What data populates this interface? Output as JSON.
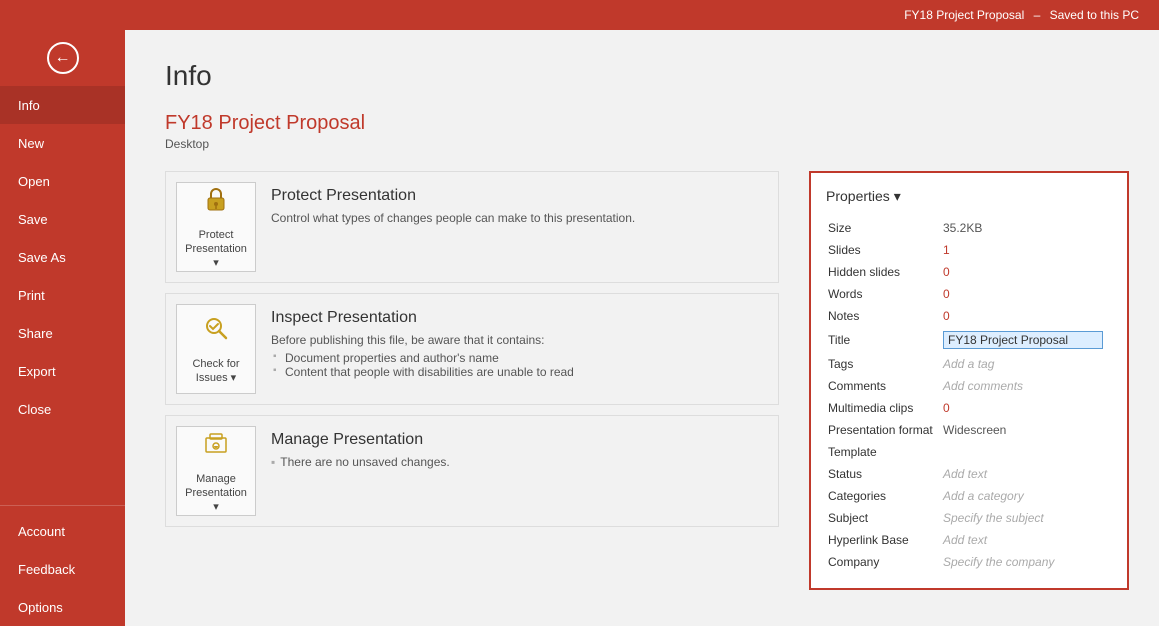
{
  "topbar": {
    "filename": "FY18 Project Proposal",
    "status": "Saved to this PC",
    "separator": "–"
  },
  "sidebar": {
    "back_icon": "←",
    "items": [
      {
        "id": "info",
        "label": "Info",
        "active": true
      },
      {
        "id": "new",
        "label": "New"
      },
      {
        "id": "open",
        "label": "Open"
      },
      {
        "id": "save",
        "label": "Save"
      },
      {
        "id": "save-as",
        "label": "Save As"
      },
      {
        "id": "print",
        "label": "Print"
      },
      {
        "id": "share",
        "label": "Share"
      },
      {
        "id": "export",
        "label": "Export"
      },
      {
        "id": "close",
        "label": "Close"
      }
    ],
    "bottom_items": [
      {
        "id": "account",
        "label": "Account"
      },
      {
        "id": "feedback",
        "label": "Feedback"
      },
      {
        "id": "options",
        "label": "Options"
      }
    ]
  },
  "content": {
    "page_title": "Info",
    "file_name": "FY18 Project Proposal",
    "file_location": "Desktop",
    "sections": [
      {
        "id": "protect",
        "icon": "🔒",
        "icon_label": "Protect\nPresentation ▾",
        "title": "Protect Presentation",
        "description": "Control what types of changes people can make to this presentation.",
        "bullets": []
      },
      {
        "id": "check",
        "icon": "🔍",
        "icon_label": "Check for\nIssues ▾",
        "title": "Inspect Presentation",
        "description": "Before publishing this file, be aware that it contains:",
        "bullets": [
          "Document properties and author's name",
          "Content that people with disabilities are unable to read"
        ]
      },
      {
        "id": "manage",
        "icon": "📁",
        "icon_label": "Manage\nPresentation ▾",
        "title": "Manage Presentation",
        "description": "There are no unsaved changes.",
        "bullets": []
      }
    ],
    "properties": {
      "header": "Properties ▾",
      "rows": [
        {
          "label": "Size",
          "value": "35.2KB",
          "style": "normal"
        },
        {
          "label": "Slides",
          "value": "1",
          "style": "orange"
        },
        {
          "label": "Hidden slides",
          "value": "0",
          "style": "orange"
        },
        {
          "label": "Words",
          "value": "0",
          "style": "orange"
        },
        {
          "label": "Notes",
          "value": "0",
          "style": "orange"
        },
        {
          "label": "Title",
          "value": "FY18 Project Proposal",
          "style": "input"
        },
        {
          "label": "Tags",
          "value": "Add a tag",
          "style": "link"
        },
        {
          "label": "Comments",
          "value": "Add comments",
          "style": "link"
        },
        {
          "label": "Multimedia clips",
          "value": "0",
          "style": "orange"
        },
        {
          "label": "Presentation format",
          "value": "Widescreen",
          "style": "normal"
        },
        {
          "label": "Template",
          "value": "",
          "style": "normal"
        },
        {
          "label": "Status",
          "value": "Add text",
          "style": "link"
        },
        {
          "label": "Categories",
          "value": "Add a category",
          "style": "link"
        },
        {
          "label": "Subject",
          "value": "Specify the subject",
          "style": "link"
        },
        {
          "label": "Hyperlink Base",
          "value": "Add text",
          "style": "link"
        },
        {
          "label": "Company",
          "value": "Specify the company",
          "style": "link"
        }
      ]
    }
  }
}
